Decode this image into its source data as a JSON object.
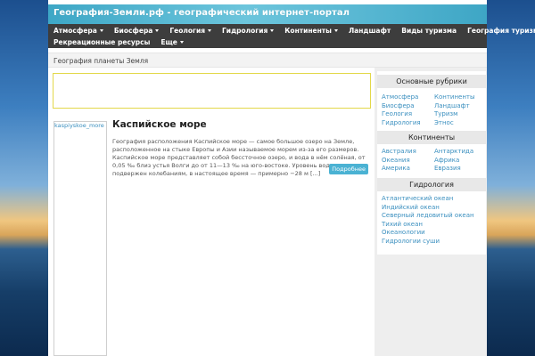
{
  "header": {
    "site_title": "География-Земли.рф - географический интернет-портал"
  },
  "nav": {
    "row1": [
      {
        "label": "Атмосфера",
        "dropdown": true
      },
      {
        "label": "Биосфера",
        "dropdown": true
      },
      {
        "label": "Геология",
        "dropdown": true
      },
      {
        "label": "Гидрология",
        "dropdown": true
      },
      {
        "label": "Континенты",
        "dropdown": true
      },
      {
        "label": "Ландшафт",
        "dropdown": false
      },
      {
        "label": "Виды туризма",
        "dropdown": false
      },
      {
        "label": "География туризма",
        "dropdown": false
      }
    ],
    "row2": [
      {
        "label": "Рекреационные ресурсы",
        "dropdown": false
      },
      {
        "label": "Еще",
        "dropdown": true
      }
    ]
  },
  "breadcrumb": {
    "text": "География планеты Земля"
  },
  "article": {
    "thumb_alt": "kaspiyskoe_more",
    "title": "Каспийское море",
    "excerpt": "География расположения Каспийское море — самое большое озеро на Земле, расположенное на стыке Европы и Азии называемое морем из-за его размеров. Каспийское море представляет собой бессточное озеро, и вода в нём солёная, от 0,05 ‰ близ устья Волги до от 11—13 ‰ на юго-востоке. Уровень воды подвержен колебаниям, в настоящее время — примерно −28 м [...]",
    "read_more": "Подробнее"
  },
  "sidebar": {
    "rubrics": {
      "title": "Основные рубрики",
      "col1": [
        "Атмосфера",
        "Биосфера",
        "Геология",
        "Гидрология"
      ],
      "col2": [
        "Континенты",
        "Ландшафт",
        "Туризм",
        "Этнос"
      ]
    },
    "continents": {
      "title": "Континенты",
      "col1": [
        "Австралия",
        "Океания",
        "Америка"
      ],
      "col2": [
        "Антарктида",
        "Африка",
        "Евразия"
      ]
    },
    "hydrology": {
      "title": "Гидрология",
      "items": [
        "Атлантический океан",
        "Индийский океан",
        "Северный ледовитый океан",
        "Тихий океан",
        "Океанологии",
        "Гидрологии суши"
      ]
    }
  },
  "colors": {
    "header_accent": "#4ab2d3",
    "nav_bg": "#3d3d3d",
    "link": "#3a8fbf"
  }
}
